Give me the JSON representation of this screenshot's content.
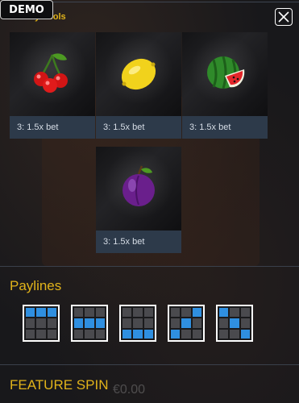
{
  "demo_label": "DEMO",
  "low_symbols": {
    "title": "Low symbols",
    "cards": [
      {
        "symbol": "cherry",
        "payout": "3:  1.5x bet"
      },
      {
        "symbol": "lemon",
        "payout": "3:  1.5x bet"
      },
      {
        "symbol": "watermelon",
        "payout": "3:  1.5x bet"
      },
      {
        "symbol": "plum",
        "payout": "3:  1.5x bet"
      }
    ]
  },
  "paylines": {
    "title": "Paylines",
    "patterns": [
      [
        [
          1,
          1,
          1
        ],
        [
          0,
          0,
          0
        ],
        [
          0,
          0,
          0
        ]
      ],
      [
        [
          0,
          0,
          0
        ],
        [
          1,
          1,
          1
        ],
        [
          0,
          0,
          0
        ]
      ],
      [
        [
          0,
          0,
          0
        ],
        [
          0,
          0,
          0
        ],
        [
          1,
          1,
          1
        ]
      ],
      [
        [
          0,
          0,
          1
        ],
        [
          0,
          1,
          0
        ],
        [
          1,
          0,
          0
        ]
      ],
      [
        [
          1,
          0,
          0
        ],
        [
          0,
          1,
          0
        ],
        [
          0,
          0,
          1
        ]
      ]
    ]
  },
  "feature_spin": {
    "title": "FEATURE SPIN"
  },
  "background": {
    "amount": "€0.00"
  },
  "colors": {
    "accent": "#e1b31a",
    "payout_bar": "#2d3a4a",
    "payline_on": "#2f8fe0",
    "payline_off": "#4a4a4e"
  },
  "icons": {
    "close": "close-icon"
  }
}
